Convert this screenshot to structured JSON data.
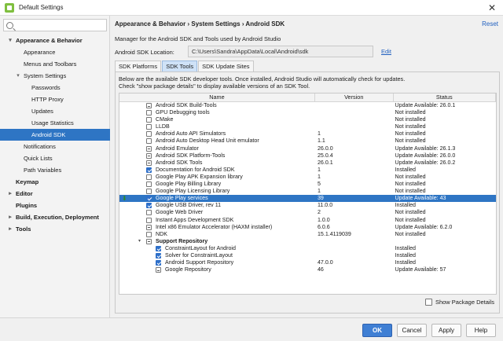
{
  "window": {
    "title": "Default Settings"
  },
  "search": {
    "placeholder": "Q-",
    "value": ""
  },
  "sidebar": {
    "items": [
      {
        "label": "Appearance & Behavior",
        "level": 0,
        "bold": true,
        "expanded": true
      },
      {
        "label": "Appearance",
        "level": 1
      },
      {
        "label": "Menus and Toolbars",
        "level": 1
      },
      {
        "label": "System Settings",
        "level": 1,
        "expanded": true
      },
      {
        "label": "Passwords",
        "level": 2
      },
      {
        "label": "HTTP Proxy",
        "level": 2
      },
      {
        "label": "Updates",
        "level": 2
      },
      {
        "label": "Usage Statistics",
        "level": 2
      },
      {
        "label": "Android SDK",
        "level": 2,
        "selected": true
      },
      {
        "label": "Notifications",
        "level": 1
      },
      {
        "label": "Quick Lists",
        "level": 1
      },
      {
        "label": "Path Variables",
        "level": 1
      },
      {
        "label": "Keymap",
        "level": 0,
        "bold": true
      },
      {
        "label": "Editor",
        "level": 0,
        "bold": true,
        "collapsed": true
      },
      {
        "label": "Plugins",
        "level": 0,
        "bold": true
      },
      {
        "label": "Build, Execution, Deployment",
        "level": 0,
        "bold": true,
        "collapsed": true
      },
      {
        "label": "Tools",
        "level": 0,
        "bold": true,
        "collapsed": true
      }
    ]
  },
  "main": {
    "breadcrumb": "Appearance & Behavior › System Settings › Android SDK",
    "reset_label": "Reset",
    "description": "Manager for the Android SDK and Tools used by Android Studio",
    "location_label": "Android SDK Location:",
    "location_value": "C:\\Users\\Sandra\\AppData\\Local\\Android\\sdk",
    "edit_label": "Edit",
    "tabs": [
      {
        "label": "SDK Platforms",
        "active": false
      },
      {
        "label": "SDK Tools",
        "active": true
      },
      {
        "label": "SDK Update Sites",
        "active": false
      }
    ],
    "info_line1": "Below are the available SDK developer tools. Once installed, Android Studio will automatically check for updates.",
    "info_line2": "Check \"show package details\" to display available versions of an SDK Tool.",
    "columns": {
      "name": "Name",
      "version": "Version",
      "status": "Status"
    },
    "rows": [
      {
        "name": "Android SDK Build-Tools",
        "version": "",
        "status": "Update Available: 26.0.1",
        "check": "partial",
        "indent": 0
      },
      {
        "name": "GPU Debugging tools",
        "version": "",
        "status": "Not installed",
        "check": "none",
        "indent": 0
      },
      {
        "name": "CMake",
        "version": "",
        "status": "Not installed",
        "check": "none",
        "indent": 0
      },
      {
        "name": "LLDB",
        "version": "",
        "status": "Not installed",
        "check": "none",
        "indent": 0
      },
      {
        "name": "Android Auto API Simulators",
        "version": "1",
        "status": "Not installed",
        "check": "none",
        "indent": 0
      },
      {
        "name": "Android Auto Desktop Head Unit emulator",
        "version": "1.1",
        "status": "Not installed",
        "check": "none",
        "indent": 0
      },
      {
        "name": "Android Emulator",
        "version": "26.0.0",
        "status": "Update Available: 26.1.3",
        "check": "partial",
        "indent": 0
      },
      {
        "name": "Android SDK Platform-Tools",
        "version": "25.0.4",
        "status": "Update Available: 26.0.0",
        "check": "partial",
        "indent": 0
      },
      {
        "name": "Android SDK Tools",
        "version": "26.0.1",
        "status": "Update Available: 26.0.2",
        "check": "partial",
        "indent": 0
      },
      {
        "name": "Documentation for Android SDK",
        "version": "1",
        "status": "Installed",
        "check": "checked",
        "indent": 0
      },
      {
        "name": "Google Play APK Expansion library",
        "version": "1",
        "status": "Not installed",
        "check": "none",
        "indent": 0
      },
      {
        "name": "Google Play Billing Library",
        "version": "5",
        "status": "Not installed",
        "check": "none",
        "indent": 0
      },
      {
        "name": "Google Play Licensing Library",
        "version": "1",
        "status": "Not installed",
        "check": "none",
        "indent": 0
      },
      {
        "name": "Google Play services",
        "version": "39",
        "status": "Update Available: 43",
        "check": "checked",
        "indent": 0,
        "selected": true,
        "download": true
      },
      {
        "name": "Google USB Driver, rev 11",
        "version": "11.0.0",
        "status": "Installed",
        "check": "checked",
        "indent": 0
      },
      {
        "name": "Google Web Driver",
        "version": "2",
        "status": "Not installed",
        "check": "none",
        "indent": 0
      },
      {
        "name": "Instant Apps Development SDK",
        "version": "1.0.0",
        "status": "Not installed",
        "check": "none",
        "indent": 0
      },
      {
        "name": "Intel x86 Emulator Accelerator (HAXM installer)",
        "version": "6.0.6",
        "status": "Update Available: 6.2.0",
        "check": "partial",
        "indent": 0
      },
      {
        "name": "NDK",
        "version": "15.1.4119039",
        "status": "Not installed",
        "check": "none",
        "indent": 0
      },
      {
        "name": "Support Repository",
        "version": "",
        "status": "",
        "check": "partial",
        "indent": 0,
        "group": true
      },
      {
        "name": "ConstraintLayout for Android",
        "version": "",
        "status": "Installed",
        "check": "checked",
        "indent": 1
      },
      {
        "name": "Solver for ConstraintLayout",
        "version": "",
        "status": "Installed",
        "check": "checked",
        "indent": 1
      },
      {
        "name": "Android Support Repository",
        "version": "47.0.0",
        "status": "Installed",
        "check": "checked",
        "indent": 1
      },
      {
        "name": "Google Repository",
        "version": "46",
        "status": "Update Available: 57",
        "check": "partial",
        "indent": 1
      }
    ],
    "show_package_details_label": "Show Package Details"
  },
  "buttons": {
    "ok": "OK",
    "cancel": "Cancel",
    "apply": "Apply",
    "help": "Help"
  }
}
